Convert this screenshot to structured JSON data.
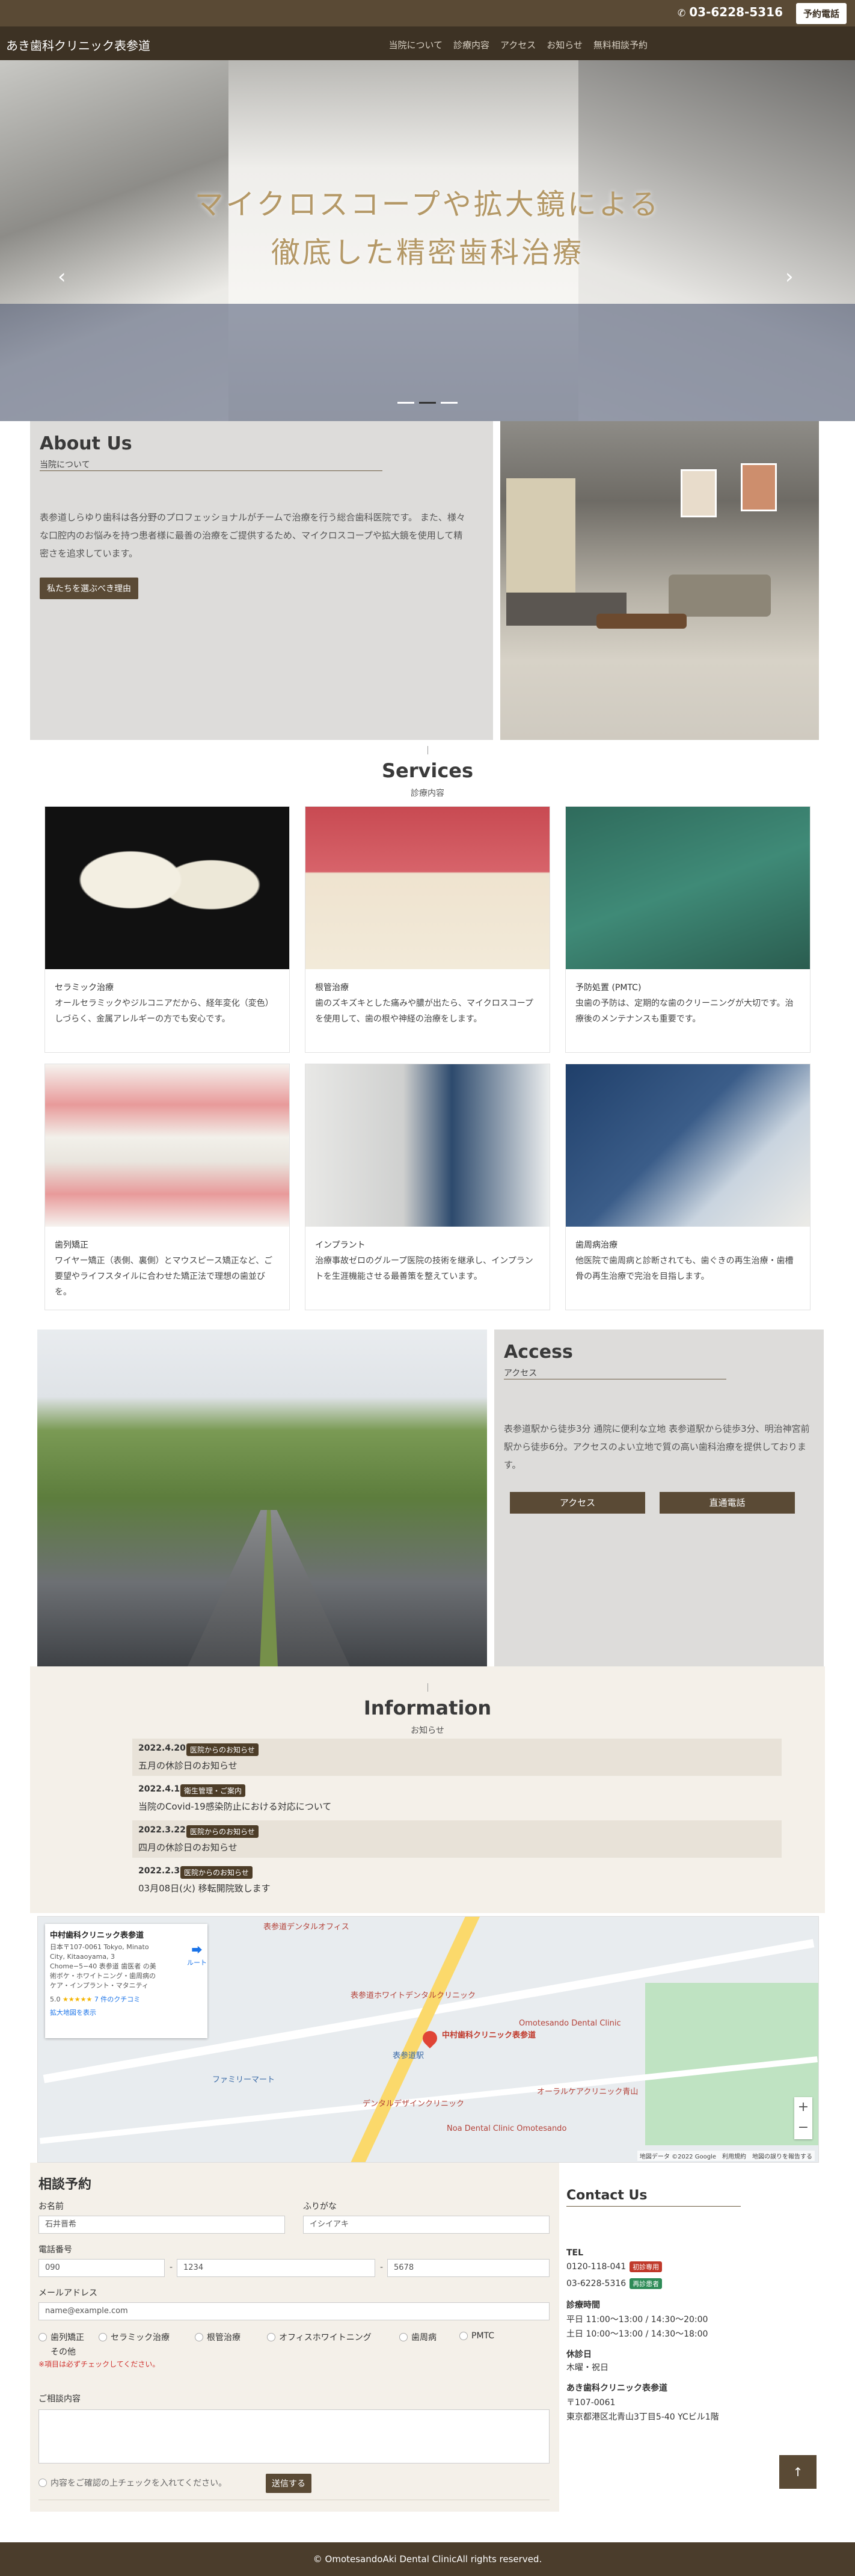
{
  "topbar": {
    "phone": "03-6228-5316",
    "book_label": "予約電話"
  },
  "nav": {
    "brand": "あき歯科クリニック表参道",
    "items": [
      "当院について",
      "診療内容",
      "アクセス",
      "お知らせ",
      "無料相談予約"
    ]
  },
  "hero": {
    "line1": "マイクロスコープや拡大鏡による",
    "line2": "徹底した精密歯科治療",
    "prev_glyph": "‹",
    "next_glyph": "›"
  },
  "about": {
    "title": "About Us",
    "subtitle": "当院について",
    "body": "表参道しらゆり歯科は各分野のプロフェッショナルがチームで治療を行う総合歯科医院です。 また、様々な口腔内のお悩みを持つ患者様に最善の治療をご提供するため、マイクロスコープや拡大鏡を使用して精密さを追求しています。",
    "button": "私たちを選ぶべき理由"
  },
  "services": {
    "title": "Services",
    "subtitle": "診療内容",
    "cards": [
      {
        "title": "セラミック治療",
        "desc": "オールセラミックやジルコニアだから、経年変化（変色）しづらく、金属アレルギーの方でも安心です。"
      },
      {
        "title": "根管治療",
        "desc": "歯のズキズキとした痛みや膿が出たら、マイクロスコープを使用して、歯の根や神経の治療をします。"
      },
      {
        "title": "予防処置 (PMTC)",
        "desc": "虫歯の予防は、定期的な歯のクリーニングが大切です。治療後のメンテナンスも重要です。"
      },
      {
        "title": "歯列矯正",
        "desc": "ワイヤー矯正（表側、裏側）とマウスピース矯正など、ご要望やライフスタイルに合わせた矯正法で理想の歯並びを。"
      },
      {
        "title": "インプラント",
        "desc": "治療事故ゼロのグループ医院の技術を継承し、インプラントを生涯機能させる最善策を整えています。"
      },
      {
        "title": "歯周病治療",
        "desc": "他医院で歯周病と診断されても、歯ぐきの再生治療・歯槽骨の再生治療で完治を目指します。"
      }
    ]
  },
  "access": {
    "title": "Access",
    "subtitle": "アクセス",
    "body": "表参道駅から徒歩3分 通院に便利な立地 表参道駅から徒歩3分、明治神宮前駅から徒歩6分。アクセスのよい立地で質の高い歯科治療を提供しております。",
    "btn_access": "アクセス",
    "btn_phone": "直通電話"
  },
  "info": {
    "title": "Information",
    "subtitle": "お知らせ",
    "items": [
      {
        "date": "2022.4.20",
        "badge": "医院からのお知らせ",
        "text": "五月の休診日のお知らせ"
      },
      {
        "date": "2022.4.1",
        "badge": "衛生管理・ご案内",
        "text": "当院のCovid-19感染防止における対応について"
      },
      {
        "date": "2022.3.22",
        "badge": "医院からのお知らせ",
        "text": "四月の休診日のお知らせ"
      },
      {
        "date": "2022.2.3",
        "badge": "医院からのお知らせ",
        "text": "03月08日(火) 移転開院致します"
      }
    ]
  },
  "map": {
    "place_name": "中村歯科クリニック表参道",
    "address": "日本〒107-0061 Tokyo, Minato City, Kitaaoyama, 3 Chome−5−40 表参道 歯医者 の美術ボケ・ホワイトニング・歯周病のケア・インプラント・マタニティ",
    "rating": "5.0",
    "stars": "★★★★★",
    "reviews": "7 件のクチコミ",
    "larger_map": "拡大地図を表示",
    "directions": "ルート",
    "pin_label": "中村歯科クリニック表参道",
    "labels": [
      "表参道デンタルオフィス",
      "表参道ホワイトデンタルクリニック",
      "Omotesando Dental Clinic",
      "デンタルデザインクリニック",
      "オーラルケアクリニック青山",
      "Noa Dental Clinic Omotesando",
      "表参道駅",
      "ファミリーマート"
    ],
    "credits": "地図データ ©2022 Google　利用規約　地図の誤りを報告する"
  },
  "form": {
    "title": "相談予約",
    "name_label": "お名前",
    "name_placeholder": "石井晋希",
    "kana_label": "ふりがな",
    "kana_placeholder": "イシイアキ",
    "tel_label": "電話番号",
    "tel1": "090",
    "tel2": "1234",
    "tel3": "5678",
    "email_label": "メールアドレス",
    "email_placeholder": "name@example.com",
    "options": [
      "歯列矯正",
      "セラミック治療",
      "根管治療",
      "オフィスホワイトニング",
      "歯周病",
      "PMTC",
      "その他"
    ],
    "warning": "※項目は必ずチェックしてください。",
    "message_label": "ご相談内容",
    "agree_label": "内容をご確認の上チェックを入れてください。",
    "submit": "送信する"
  },
  "contact": {
    "title": "Contact Us",
    "tel_label": "TEL",
    "tel1": "0120-118-041",
    "tel1_badge": "初診専用",
    "tel2": "03-6228-5316",
    "tel2_badge": "再診患者",
    "hours_label": "診療時間",
    "hours1": "平日 11:00〜13:00 / 14:30〜20:00",
    "hours2": "土日 10:00〜13:00 / 14:30〜18:00",
    "closed_label": "休診日",
    "closed": "木曜・祝日",
    "clinic_name": "あき歯科クリニック表参道",
    "zip": "〒107-0061",
    "address": "東京都港区北青山3丁目5-40 YCビル1階",
    "badge_red": "#c0392b",
    "badge_green": "#2e8b57"
  },
  "footer": {
    "copyright": "© OmotesandoAki Dental ClinicAll rights reserved."
  }
}
